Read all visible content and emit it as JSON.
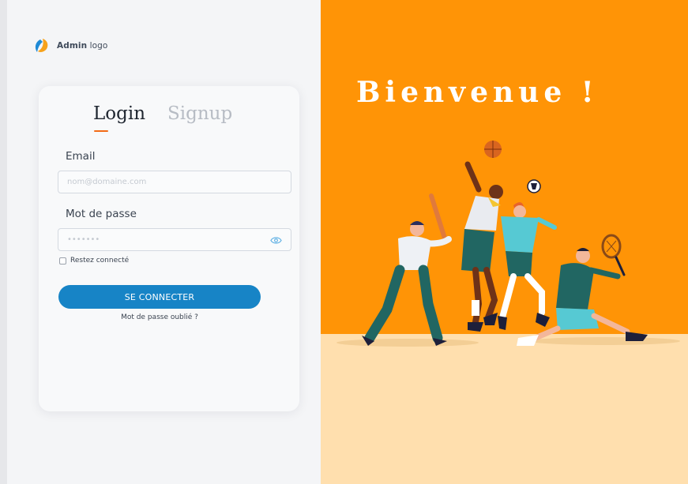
{
  "logo": {
    "brand": "Admin",
    "suffix": "logo"
  },
  "tabs": [
    {
      "label": "Login",
      "active": true
    },
    {
      "label": "Signup",
      "active": false
    }
  ],
  "form": {
    "email_label": "Email",
    "email_placeholder": "nom@domaine.com",
    "password_label": "Mot de passe",
    "password_placeholder": "•••••••",
    "remember_label": "Restez connecté",
    "remember_checked": false,
    "submit_label": "SE CONNECTER",
    "forgot_label": "Mot de passe oublié ?"
  },
  "hero": {
    "title": "Bienvenue !"
  },
  "icons": {
    "logo": "logo-icon",
    "password_visibility": "eye-icon"
  },
  "colors": {
    "accent": "#1784c6",
    "tab_indicator": "#f36b16",
    "hero_background": "#ff9406",
    "hero_floor": "#ffdfae"
  }
}
